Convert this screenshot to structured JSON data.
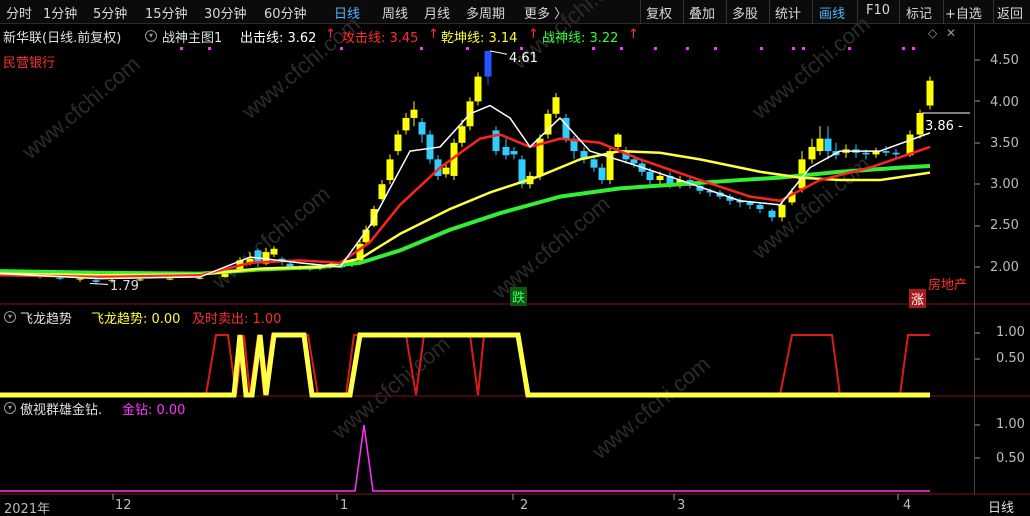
{
  "toolbar": {
    "left": [
      "分时",
      "1分钟",
      "5分钟",
      "15分钟",
      "30分钟",
      "60分钟",
      "日线",
      "周线",
      "月线",
      "多周期",
      "更多 〉"
    ],
    "active": "日线",
    "right": [
      "复权",
      "叠加",
      "多股",
      "统计",
      "画线",
      "F10",
      "标记",
      "+自选",
      "返回"
    ],
    "right_active": "画线"
  },
  "main": {
    "stock_title": "新华联(日线.前复权)",
    "indicator_name": "战神主图1",
    "legend": [
      {
        "label": "出击线: 3.62",
        "arrow": "↑",
        "color": "#ffffff"
      },
      {
        "label": "攻击线: 3.45",
        "arrow": "↑",
        "color": "#ff2a2a"
      },
      {
        "label": "乾坤线: 3.14",
        "arrow": "↑",
        "color": "#ffff33"
      },
      {
        "label": "战神线: 3.22",
        "arrow": "↑",
        "color": "#33ff33"
      }
    ],
    "sector_left": "民营银行",
    "sector_right": "房地产",
    "high_label": "4.61",
    "low_label": "1.79",
    "last_price": "3.86",
    "fall_badge": "跌",
    "rise_badge": "涨",
    "y_ticks": [
      "4.50",
      "4.00",
      "3.50",
      "3.00",
      "2.50",
      "2.00"
    ]
  },
  "panel2": {
    "name": "飞龙趋势",
    "legend": [
      {
        "label": "飞龙趋势: 0.00",
        "color": "#ffff33"
      },
      {
        "label": "及时卖出: 1.00",
        "color": "#ff2a2a"
      }
    ],
    "y_ticks": [
      "1.00",
      "0.50"
    ]
  },
  "panel3": {
    "name": "傲视群雄金钻.",
    "legend": [
      {
        "label": "金钻: 0.00",
        "color": "#ff33ff"
      }
    ],
    "y_ticks": [
      "1.00",
      "0.50"
    ]
  },
  "x_axis": {
    "labels": [
      "2021年",
      "12",
      "1",
      "2",
      "3",
      "4"
    ],
    "period_button": "日线"
  },
  "watermark": "www.cfchi.com",
  "colors": {
    "up": "#ffff00",
    "down": "#33ccff",
    "ma_white": "#ffffff",
    "ma_red": "#ff2222",
    "ma_yellow": "#ffff44",
    "ma_green": "#33ee33",
    "magenta": "#ff33ff",
    "accent": "#4fb6ff"
  }
}
